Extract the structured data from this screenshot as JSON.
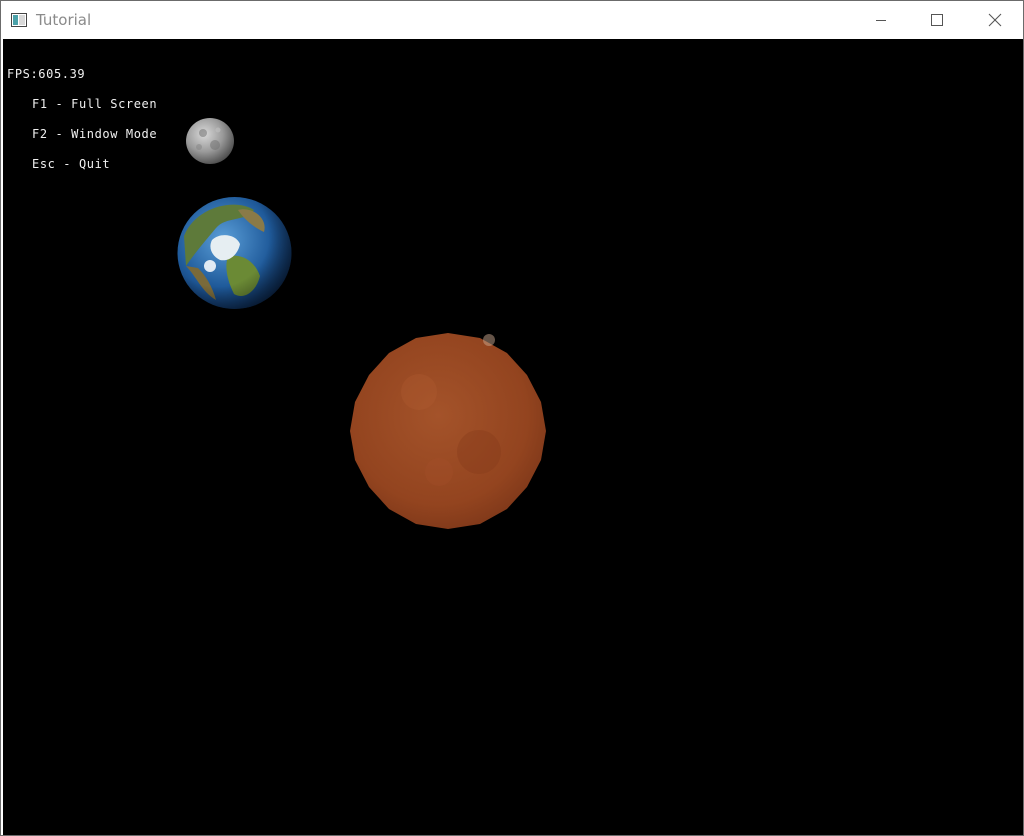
{
  "window": {
    "title": "Tutorial",
    "icon": "app-window-icon",
    "controls": {
      "minimize_icon": "minimize-icon",
      "maximize_icon": "maximize-icon",
      "close_icon": "close-icon"
    }
  },
  "hud": {
    "fps": "FPS:605.39",
    "help": [
      "F1 - Full Screen",
      "F2 - Window Mode",
      "Esc - Quit"
    ]
  },
  "scene": {
    "background": "#000000",
    "bodies": [
      {
        "name": "moon",
        "color": "#a8a8a8"
      },
      {
        "name": "earth",
        "color": "#2a66a8"
      },
      {
        "name": "sun",
        "color": "#9c4a22"
      }
    ]
  }
}
